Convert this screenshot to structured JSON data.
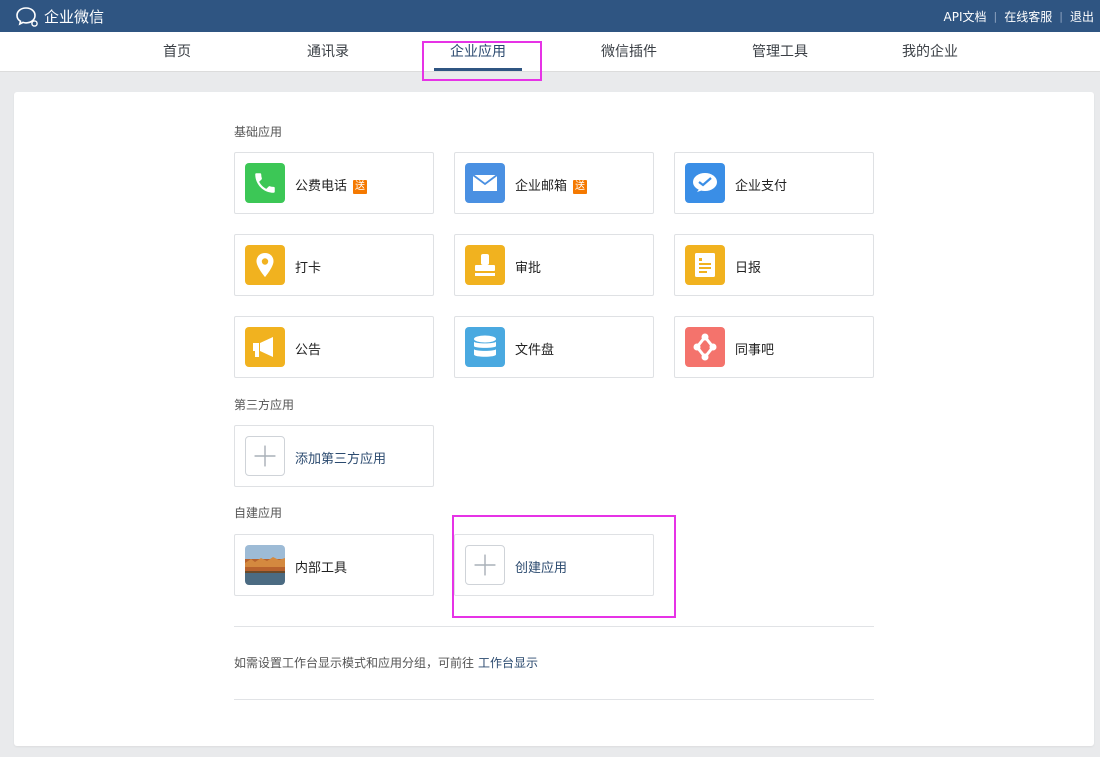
{
  "header": {
    "app_title": "企业微信",
    "links": [
      "API文档",
      "在线客服",
      "退出"
    ]
  },
  "nav": {
    "tabs": [
      "首页",
      "通讯录",
      "企业应用",
      "微信插件",
      "管理工具",
      "我的企业"
    ],
    "active": "企业应用"
  },
  "sections": {
    "basic": {
      "title": "基础应用",
      "apps": [
        {
          "label": "公费电话",
          "badge": "送",
          "icon": "phone-icon",
          "color": "#3cc756"
        },
        {
          "label": "企业邮箱",
          "badge": "送",
          "icon": "mail-icon",
          "color": "#4a90e2"
        },
        {
          "label": "企业支付",
          "icon": "pay-icon",
          "color": "#3a8ee6"
        },
        {
          "label": "打卡",
          "icon": "location-pin-icon",
          "color": "#f1b21f"
        },
        {
          "label": "审批",
          "icon": "stamp-icon",
          "color": "#f1b21f"
        },
        {
          "label": "日报",
          "icon": "report-icon",
          "color": "#f1b21f"
        },
        {
          "label": "公告",
          "icon": "megaphone-icon",
          "color": "#f1b21f"
        },
        {
          "label": "文件盘",
          "icon": "database-icon",
          "color": "#4aa9e0"
        },
        {
          "label": "同事吧",
          "icon": "network-icon",
          "color": "#f4736c"
        }
      ]
    },
    "third_party": {
      "title": "第三方应用",
      "add_label": "添加第三方应用"
    },
    "custom": {
      "title": "自建应用",
      "apps": [
        {
          "label": "内部工具",
          "icon": "landscape-photo-icon"
        }
      ],
      "create_label": "创建应用"
    }
  },
  "footer_hint": {
    "text": "如需设置工作台显示模式和应用分组，可前往",
    "link": "工作台显示"
  }
}
